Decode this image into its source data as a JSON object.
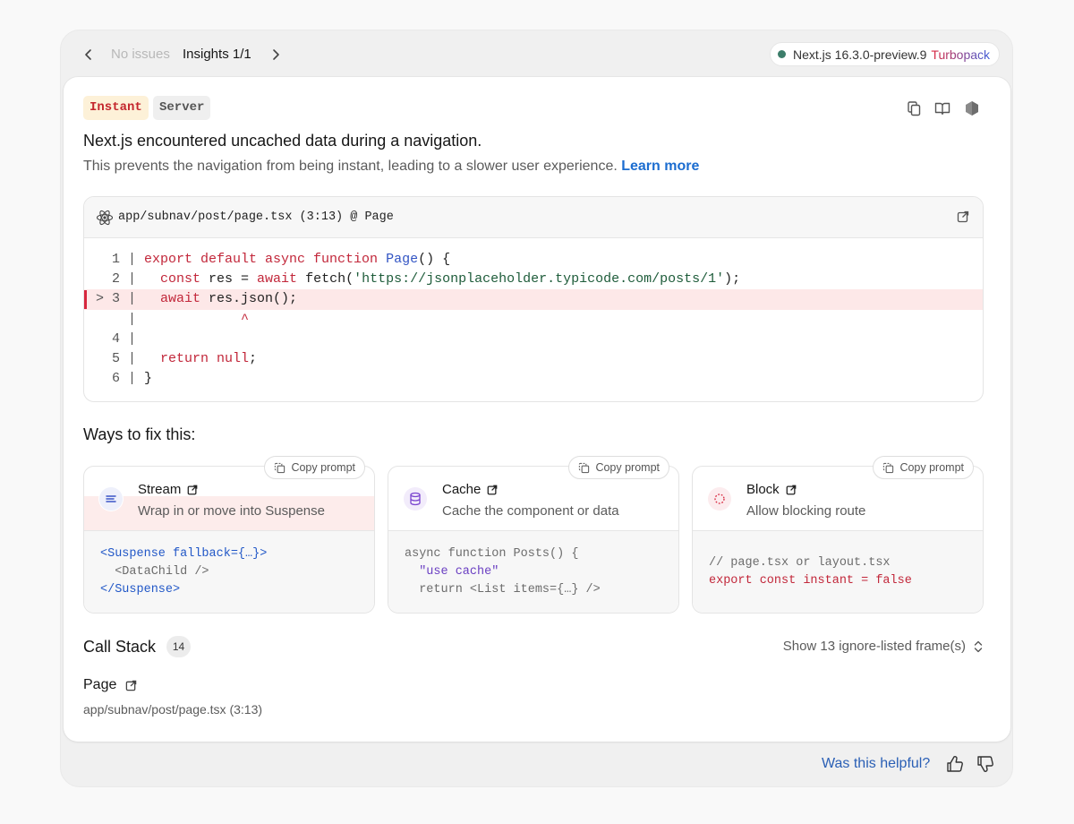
{
  "topbar": {
    "no_issues": "No issues",
    "insights": "Insights 1/1",
    "version": "Next.js 16.3.0-preview.9",
    "bundler": "Turbopack"
  },
  "badges": {
    "instant": "Instant",
    "server": "Server"
  },
  "header": {
    "title": "Next.js encountered uncached data during a navigation.",
    "description": "This prevents the navigation from being instant, leading to a slower user experience.",
    "learn_more": "Learn more"
  },
  "code": {
    "file": "app/subnav/post/page.tsx (3:13) @ Page",
    "lines": [
      {
        "num": "1",
        "text": "export default async function Page() {"
      },
      {
        "num": "2",
        "text": "const res = await fetch('https://jsonplaceholder.typicode.com/posts/1');"
      },
      {
        "num": "3",
        "marker": ">",
        "text": "await res.json();"
      },
      {
        "num": "",
        "text": "^"
      },
      {
        "num": "4",
        "text": ""
      },
      {
        "num": "5",
        "text": "return null;"
      },
      {
        "num": "6",
        "text": "}"
      }
    ]
  },
  "ways": {
    "title": "Ways to fix this:",
    "copy_label": "Copy prompt",
    "items": [
      {
        "name": "Stream",
        "subtitle": "Wrap in or move into Suspense",
        "icon": "lines-icon",
        "snippet": [
          "<Suspense fallback={…}>",
          "  <DataChild />",
          "</Suspense>"
        ]
      },
      {
        "name": "Cache",
        "subtitle": "Cache the component or data",
        "icon": "database-icon",
        "snippet": [
          "async function Posts() {",
          "  \"use cache\"",
          "  return <List items={…} />"
        ]
      },
      {
        "name": "Block",
        "subtitle": "Allow blocking route",
        "icon": "dashed-circle-icon",
        "snippet": [
          "// page.tsx or layout.tsx",
          "export const instant = false"
        ]
      }
    ]
  },
  "call_stack": {
    "title": "Call Stack",
    "count": "14",
    "toggle": "Show 13 ignore-listed frame(s)",
    "frame_name": "Page",
    "frame_path": "app/subnav/post/page.tsx (3:13)"
  },
  "footer": {
    "helpful": "Was this helpful?"
  },
  "colors": {
    "accent_blue": "#1c6dd0",
    "error_red": "#c2273a",
    "highlight_bg": "#fde8e8"
  }
}
